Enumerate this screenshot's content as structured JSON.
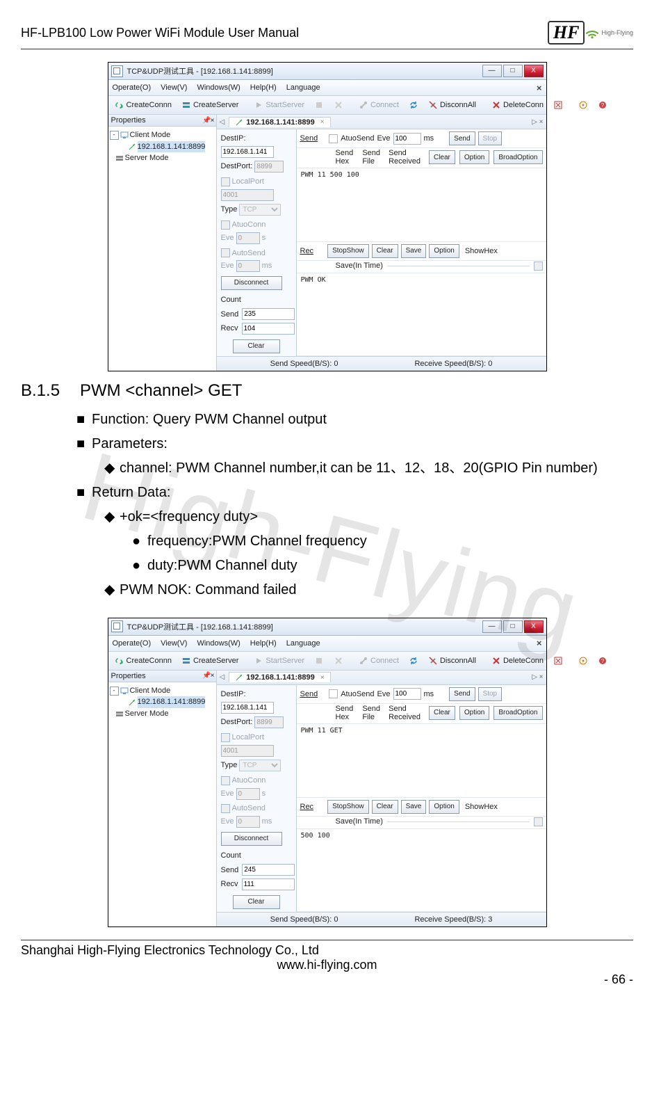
{
  "header": {
    "doc_title": "HF-LPB100 Low Power WiFi Module User Manual",
    "logo_text": "HF",
    "logo_sub": "High-Flying"
  },
  "watermark": "High-Flying",
  "section": {
    "number": "B.1.5",
    "title": "PWM <channel> GET",
    "bullets": {
      "function": "Function: Query PWM Channel output",
      "parameters_label": "Parameters:",
      "param_channel": "channel: PWM Channel number,it can be 11、12、18、20(GPIO Pin number)",
      "return_label": "Return Data:",
      "ok_line": "+ok=<frequency duty>",
      "ok_freq": "frequency:PWM Channel frequency",
      "ok_duty": "duty:PWM Channel duty",
      "nok_line": "PWM NOK: Command failed"
    }
  },
  "app": {
    "title": "TCP&UDP测试工具 - [192.168.1.141:8899]",
    "win": {
      "min": "—",
      "max": "□",
      "close": "X"
    },
    "menu": {
      "operate": "Operate(O)",
      "view": "View(V)",
      "windows": "Windows(W)",
      "help": "Help(H)",
      "language": "Language"
    },
    "tools": {
      "createConn": "CreateConnn",
      "createServer": "CreateServer",
      "startServer": "StartServer",
      "connect": "Connect",
      "disconnAll": "DisconnAll",
      "deleteConn": "DeleteConn"
    },
    "props_title": "Properties",
    "tree": {
      "client": "Client Mode",
      "child": "192.168.1.141:8899",
      "server": "Server Mode"
    },
    "tab": "192.168.1.141:8899",
    "conn": {
      "destIpLabel": "DestIP:",
      "destIp": "192.168.1.141",
      "destPortLabel": "DestPort:",
      "destPort": "8899",
      "localPortLabel": "LocalPort",
      "localPort": "4001",
      "typeLabel": "Type",
      "type": "TCP",
      "atuo": "AtuoConn",
      "eveLabel": "Eve",
      "eveUnit1": "s",
      "autoSend": "AutoSend",
      "eveUnit2": "ms",
      "disconnect": "Disconnect",
      "countLabel": "Count",
      "sendLabel": "Send",
      "recvLabel": "Recv",
      "clear": "Clear"
    },
    "sendbar": {
      "send": "Send",
      "atuo": "AtuoSend",
      "eve": "Eve",
      "eveVal": "100",
      "ms": "ms",
      "sendBtn": "Send",
      "stop": "Stop",
      "hex": "Send Hex",
      "file": "Send File",
      "recv": "Send Received",
      "clear": "Clear",
      "option": "Option",
      "broad": "BroadOption"
    },
    "recbar": {
      "rec": "Rec",
      "stopShow": "StopShow",
      "clear": "Clear",
      "save": "Save",
      "option": "Option",
      "hex": "ShowHex",
      "saveTime": "Save(In Time)"
    },
    "status": {
      "sendLabel": "Send Speed(B/S): ",
      "recvLabel": "Receive Speed(B/S): "
    }
  },
  "shot1": {
    "sendLog": "PWM 11 500 100",
    "recvLog": "PWM OK",
    "sendCount": "235",
    "recvCount": "104",
    "sendSpeed": "0",
    "recvSpeed": "0"
  },
  "shot2": {
    "sendLog": "PWM 11 GET",
    "recvLog": "500 100",
    "sendCount": "245",
    "recvCount": "111",
    "sendSpeed": "0",
    "recvSpeed": "3"
  },
  "footer": {
    "company": "Shanghai High-Flying Electronics Technology Co., Ltd",
    "url": "www.hi-flying.com",
    "page": "- 66 -"
  }
}
